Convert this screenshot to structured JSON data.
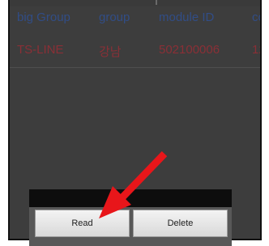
{
  "table": {
    "headers": [
      "big Group",
      "group",
      "module ID",
      "contro"
    ],
    "rows": [
      [
        "TS-LINE",
        "강남",
        "502100006",
        "1234567"
      ]
    ]
  },
  "dialog": {
    "read_label": "Read",
    "delete_label": "Delete"
  },
  "colors": {
    "header_text": "#314d86",
    "row_text": "#8a2f36",
    "overlay": "#3d3d3d",
    "annotation_arrow": "#e8161a"
  },
  "icons": {
    "annotation": "red-arrow-icon"
  }
}
